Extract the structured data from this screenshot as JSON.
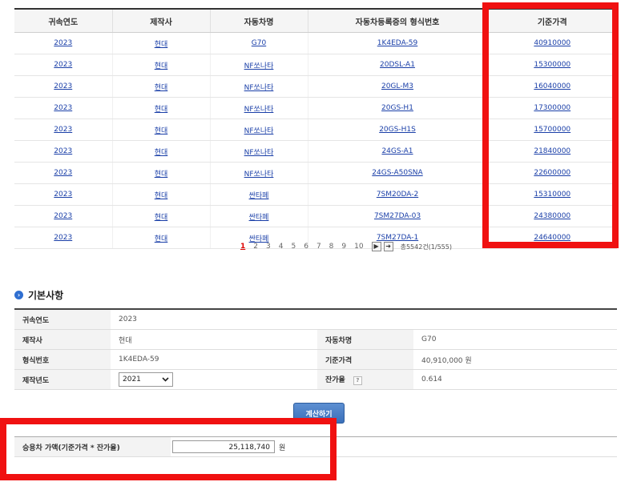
{
  "table": {
    "headers": [
      "귀속연도",
      "제작사",
      "자동차명",
      "자동차등록증의 형식번호",
      "기준가격"
    ],
    "rows": [
      [
        "2023",
        "현대",
        "G70",
        "1K4EDA-59",
        "40910000"
      ],
      [
        "2023",
        "현대",
        "NF쏘나타",
        "20DSL-A1",
        "15300000"
      ],
      [
        "2023",
        "현대",
        "NF쏘나타",
        "20GL-M3",
        "16040000"
      ],
      [
        "2023",
        "현대",
        "NF쏘나타",
        "20GS-H1",
        "17300000"
      ],
      [
        "2023",
        "현대",
        "NF쏘나타",
        "20GS-H1S",
        "15700000"
      ],
      [
        "2023",
        "현대",
        "NF쏘나타",
        "24GS-A1",
        "21840000"
      ],
      [
        "2023",
        "현대",
        "NF쏘나타",
        "24GS-A50SNA",
        "22600000"
      ],
      [
        "2023",
        "현대",
        "싼타페",
        "7SM20DA-2",
        "15310000"
      ],
      [
        "2023",
        "현대",
        "싼타페",
        "7SM27DA-03",
        "24380000"
      ],
      [
        "2023",
        "현대",
        "싼타페",
        "7SM27DA-1",
        "24640000"
      ]
    ]
  },
  "pagination": {
    "pages": [
      "1",
      "2",
      "3",
      "4",
      "5",
      "6",
      "7",
      "8",
      "9",
      "10"
    ],
    "active_page": "1",
    "next_icon": "▶",
    "last_icon": "➜",
    "total_text": "총5542건(1/555)"
  },
  "section": {
    "title": "기본사항",
    "icon": "arrow-circle-icon"
  },
  "info": {
    "year_label": "귀속연도",
    "year_value": "2023",
    "maker_label": "제작사",
    "maker_value": "현대",
    "carname_label": "자동차명",
    "carname_value": "G70",
    "type_label": "형식번호",
    "type_value": "1K4EDA-59",
    "baseprice_label": "기준가격",
    "baseprice_value": "40,910,000 원",
    "made_label": "제작년도",
    "made_value": "2021",
    "residual_label": "잔가율",
    "residual_help": "?",
    "residual_value": "0.614"
  },
  "calc_button": "계산하기",
  "result": {
    "label": "승용차 가액(기준가격 * 잔가율)",
    "value": "25,118,740",
    "unit": "원"
  },
  "colors": {
    "highlight": "#f01111",
    "link": "#1a3fa8",
    "accent": "#2f6fd1"
  }
}
